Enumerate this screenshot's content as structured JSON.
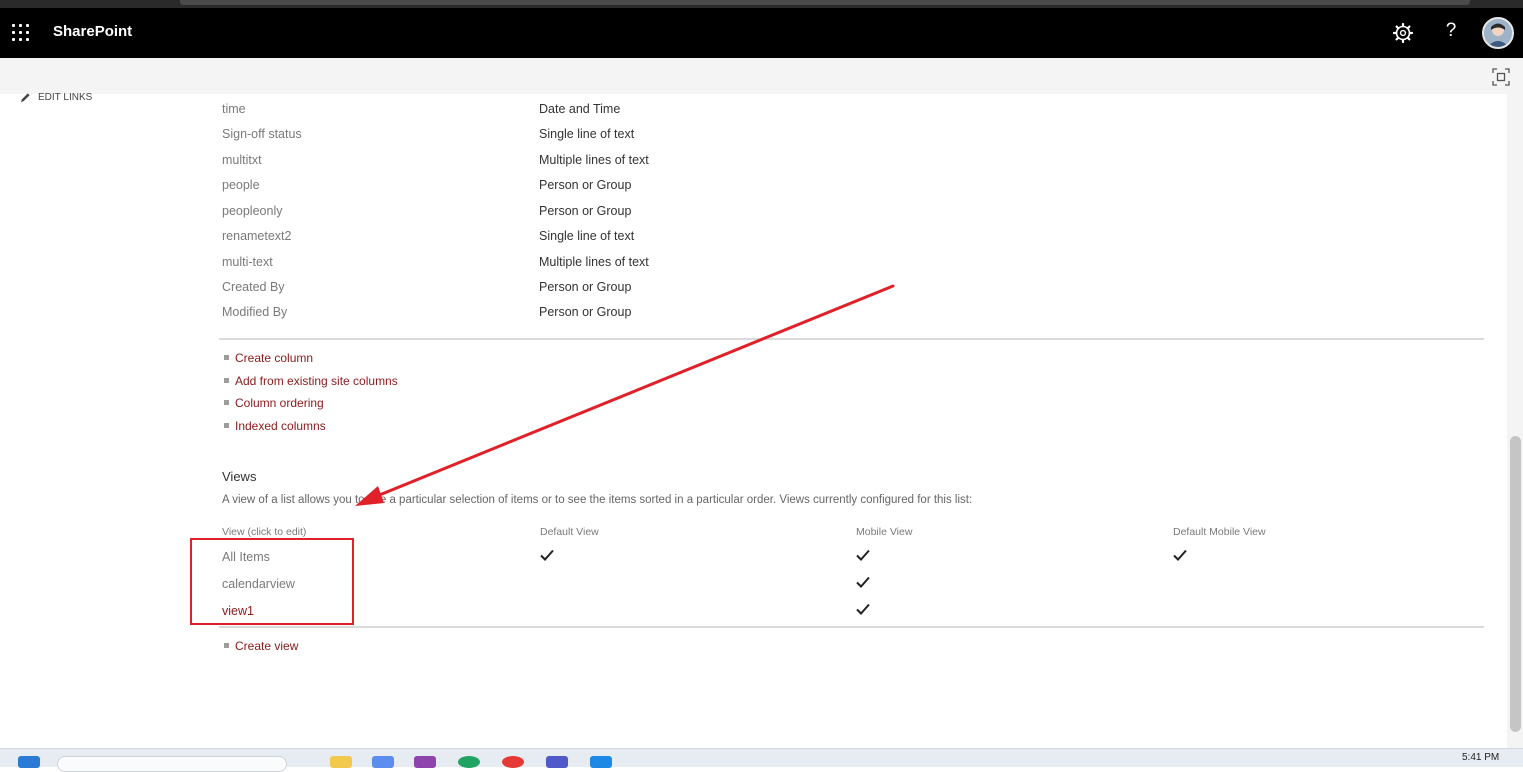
{
  "app": {
    "title": "SharePoint"
  },
  "nav": {
    "edit_links": "EDIT LINKS"
  },
  "columns": [
    {
      "name": "time",
      "type": "Date and Time"
    },
    {
      "name": "Sign-off status",
      "type": "Single line of text"
    },
    {
      "name": "multitxt",
      "type": "Multiple lines of text"
    },
    {
      "name": "people",
      "type": "Person or Group"
    },
    {
      "name": "peopleonly",
      "type": "Person or Group"
    },
    {
      "name": "renametext2",
      "type": "Single line of text"
    },
    {
      "name": "multi-text",
      "type": "Multiple lines of text"
    },
    {
      "name": "Created By",
      "type": "Person or Group"
    },
    {
      "name": "Modified By",
      "type": "Person or Group"
    }
  ],
  "column_links": [
    "Create column",
    "Add from existing site columns",
    "Column ordering",
    "Indexed columns"
  ],
  "views": {
    "heading": "Views",
    "description": "A view of a list allows you to see a particular selection of items or to see the items sorted in a particular order. Views currently configured for this list:",
    "headers": [
      "View (click to edit)",
      "Default View",
      "Mobile View",
      "Default Mobile View"
    ],
    "rows": [
      {
        "name": "All Items",
        "default_view": true,
        "mobile_view": true,
        "default_mobile_view": true
      },
      {
        "name": "calendarview",
        "default_view": false,
        "mobile_view": true,
        "default_mobile_view": false
      },
      {
        "name": "view1",
        "default_view": false,
        "mobile_view": true,
        "default_mobile_view": false
      }
    ],
    "create_view": "Create view"
  },
  "taskbar": {
    "time": "5:41 PM"
  },
  "colors": {
    "link": "#8b1a1a",
    "annotation": "#e0212a",
    "suitebar": "#000000"
  },
  "icons": [
    "waffle-icon",
    "gear-icon",
    "help-icon",
    "avatar",
    "focus-mode-icon",
    "pencil-icon",
    "checkmark-icon"
  ]
}
